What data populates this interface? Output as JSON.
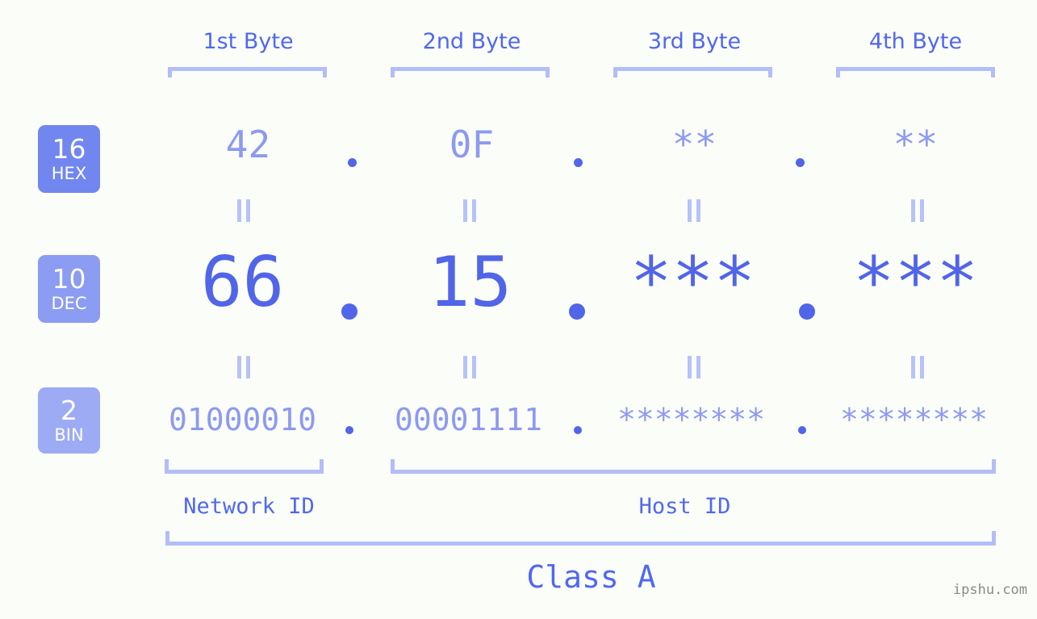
{
  "background_color": "#fbfdf8",
  "accent_colors": {
    "strong_blue": "#5165e8",
    "header_blue": "#5068ef",
    "light_blue": "#8c9af0",
    "bracket_blue": "#b3bdf7",
    "equals_blue": "#b8c2f8",
    "badge_hex": "#7186ef",
    "badge_dec": "#8b9cf2",
    "badge_bin": "#9dabf4",
    "watermark_gray": "#8a8a8a"
  },
  "byte_headers": [
    {
      "label": "1st Byte"
    },
    {
      "label": "2nd Byte"
    },
    {
      "label": "3rd Byte"
    },
    {
      "label": "4th Byte"
    }
  ],
  "bases": [
    {
      "number": "16",
      "name": "HEX"
    },
    {
      "number": "10",
      "name": "DEC"
    },
    {
      "number": "2",
      "name": "BIN"
    }
  ],
  "rows": {
    "hex": {
      "values": [
        "42",
        "0F",
        "**",
        "**"
      ],
      "separator": "."
    },
    "dec": {
      "values": [
        "66",
        "15",
        "***",
        "***"
      ],
      "separator": "."
    },
    "bin": {
      "values": [
        "01000010",
        "00001111",
        "********",
        "********"
      ],
      "separator": "."
    }
  },
  "equals_marks": {
    "symbol": "=",
    "orientation": "vertical",
    "count_per_row": 4,
    "rows": 2
  },
  "segments": {
    "network_id": "Network ID",
    "host_id": "Host ID"
  },
  "class_label": "Class A",
  "watermark": "ipshu.com"
}
